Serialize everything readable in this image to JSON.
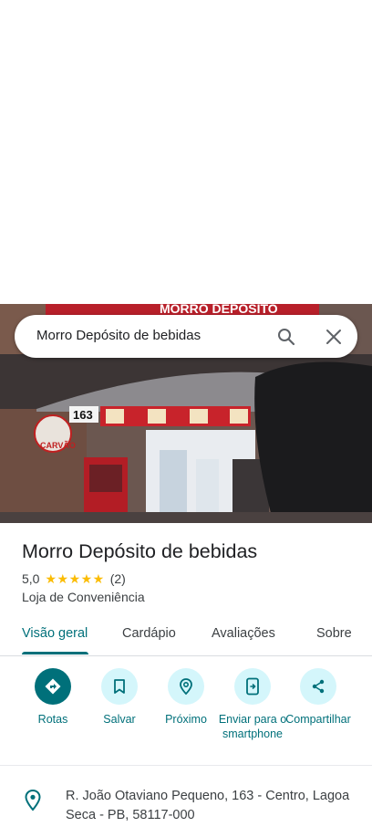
{
  "search": {
    "query": "Morro Depósito de bebidas",
    "search_icon": "search-icon",
    "close_icon": "close-icon"
  },
  "photo": {
    "sign_text": "MORRO DEPOSITO",
    "number_plate": "163",
    "carvao_text": "CARVÃO"
  },
  "place": {
    "name": "Morro Depósito de bebidas",
    "rating": "5,0",
    "stars": "★★★★★",
    "review_count": "(2)",
    "category": "Loja de Conveniência"
  },
  "tabs": [
    {
      "label": "Visão geral",
      "active": true
    },
    {
      "label": "Cardápio",
      "active": false
    },
    {
      "label": "Avaliações",
      "active": false
    },
    {
      "label": "Sobre",
      "active": false
    }
  ],
  "actions": [
    {
      "label": "Rotas",
      "icon": "directions-icon"
    },
    {
      "label": "Salvar",
      "icon": "bookmark-icon"
    },
    {
      "label": "Próximo",
      "icon": "nearby-icon"
    },
    {
      "label": "Enviar para o smartphone",
      "icon": "send-to-phone-icon"
    },
    {
      "label": "Compartilhar",
      "icon": "share-icon"
    }
  ],
  "address": {
    "text": "R. João Otaviano Pequeno, 163 - Centro, Lagoa Seca - PB, 58117-000",
    "icon": "location-pin-icon"
  },
  "colors": {
    "accent": "#00707a",
    "action_bg": "#d4f6fb",
    "star": "#fbbc04"
  }
}
